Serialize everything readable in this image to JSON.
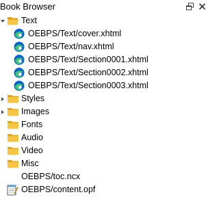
{
  "panel": {
    "title": "Book Browser"
  },
  "tree": {
    "text_folder": {
      "label": "Text",
      "icon": "folder-open-icon"
    },
    "text_files": [
      {
        "label": "OEBPS/Text/cover.xhtml",
        "icon": "edge-browser-icon"
      },
      {
        "label": "OEBPS/Text/nav.xhtml",
        "icon": "edge-browser-icon"
      },
      {
        "label": "OEBPS/Text/Section0001.xhtml",
        "icon": "edge-browser-icon"
      },
      {
        "label": "OEBPS/Text/Section0002.xhtml",
        "icon": "edge-browser-icon"
      },
      {
        "label": "OEBPS/Text/Section0003.xhtml",
        "icon": "edge-browser-icon"
      }
    ],
    "folders": [
      {
        "label": "Styles",
        "icon": "folder-icon"
      },
      {
        "label": "Images",
        "icon": "folder-icon"
      },
      {
        "label": "Fonts",
        "icon": "folder-icon"
      },
      {
        "label": "Audio",
        "icon": "folder-icon"
      },
      {
        "label": "Video",
        "icon": "folder-icon"
      },
      {
        "label": "Misc",
        "icon": "folder-icon"
      }
    ],
    "toc": {
      "label": "OEBPS/toc.ncx"
    },
    "opf": {
      "label": "OEBPS/content.opf",
      "icon": "notepad-icon"
    }
  },
  "colors": {
    "folder": "#f6c544",
    "folder_dark": "#e0a622",
    "edge_blue": "#0a64c8",
    "edge_green": "#3fc27a"
  }
}
